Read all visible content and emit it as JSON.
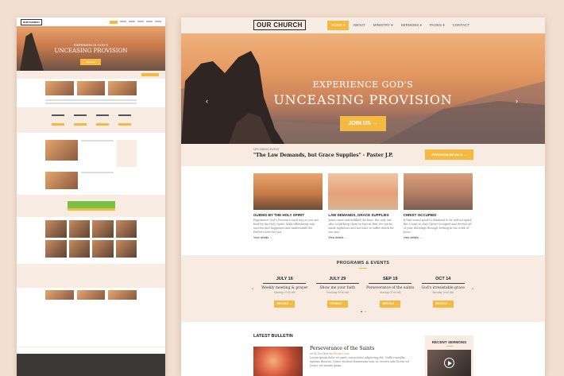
{
  "mini_preview": {
    "logo": "OUR CHURCH",
    "hero_subtitle": "EXPERIENCE GOD'S",
    "hero_title": "UNCEASING PROVISION",
    "join": "JOIN US"
  },
  "nav": {
    "logo": "OUR CHURCH",
    "items": [
      {
        "label": "HOME ▾"
      },
      {
        "label": "ABOUT"
      },
      {
        "label": "MINISTRY ▾"
      },
      {
        "label": "SERMONS ▾"
      },
      {
        "label": "PAGES ▾"
      },
      {
        "label": "CONTACT"
      }
    ]
  },
  "hero": {
    "subtitle": "EXPERIENCE GOD'S",
    "title": "UNCEASING PROVISION",
    "button": "JOIN US →",
    "prev": "‹",
    "next": "›"
  },
  "event": {
    "label": "UPCOMING EVENT",
    "title": "\"The Law Demands, but Grace Supplies\" - Paster J.P.",
    "button": "PROGRAM DETAILS →"
  },
  "cards": [
    {
      "title": "GUIDED BY THE HOLY SPIRIT",
      "text": "Experience God's Presence each day as you are lead by the Holy Spirit. Walk effortlessly into success and happiness and understand the Father's love for you.",
      "more": "View details →"
    },
    {
      "title": "LAW DEMANDS, GRACE SUPPLIES",
      "text": "Jesus came and fulfilled the laws, the only one who could keep them so that in Him we can be made righteous and not have to suffer death for our sins.",
      "more": "View details →"
    },
    {
      "title": "CHRIST OCCUPIED",
      "text": "If that sound good to Mankind to be self-occupied. But I want to stay Christ-Occupied and receive all of your blessings through resting in the work of Jesus.",
      "more": "View details →"
    }
  ],
  "programs": {
    "title": "PROGRAMS & EVENTS",
    "items": [
      {
        "date": "JULY 16",
        "name": "Weekly meeting & prayer",
        "time": "Monday 07:00 AM",
        "button": "DETAILS →"
      },
      {
        "date": "JULY 29",
        "name": "Show me your faith",
        "time": "Thursday 09:00 AM",
        "button": "DETAILS →"
      },
      {
        "date": "SEP 19",
        "name": "Perseverance of the saints",
        "time": "Monday 07:00 AM",
        "button": "DETAILS →"
      },
      {
        "date": "OCT 14",
        "name": "God's irresistable grace",
        "time": "Monday 10:00 AM",
        "button": "DETAILS →"
      }
    ],
    "prev": "‹",
    "next": "›"
  },
  "bulletin": {
    "title": "LATEST BULLETIN",
    "post_title": "Perseverance of the Saints",
    "post_meta_prefix": "on 15 Jun Olive by ",
    "post_author": "Steward Jobs",
    "post_text": "Lorem ipsum dolor sit amet, consectetur adipiscing elit. Nulla convallis egestas rhoncus. Donec facilisis fermentum sem, ac viverra ante luctus vel. Donec vel mauris quam."
  },
  "sermons": {
    "title": "RECENT SERMONS"
  },
  "colors": {
    "accent": "#f5b942",
    "band": "#f8ece2",
    "background": "#f2dfcf"
  }
}
